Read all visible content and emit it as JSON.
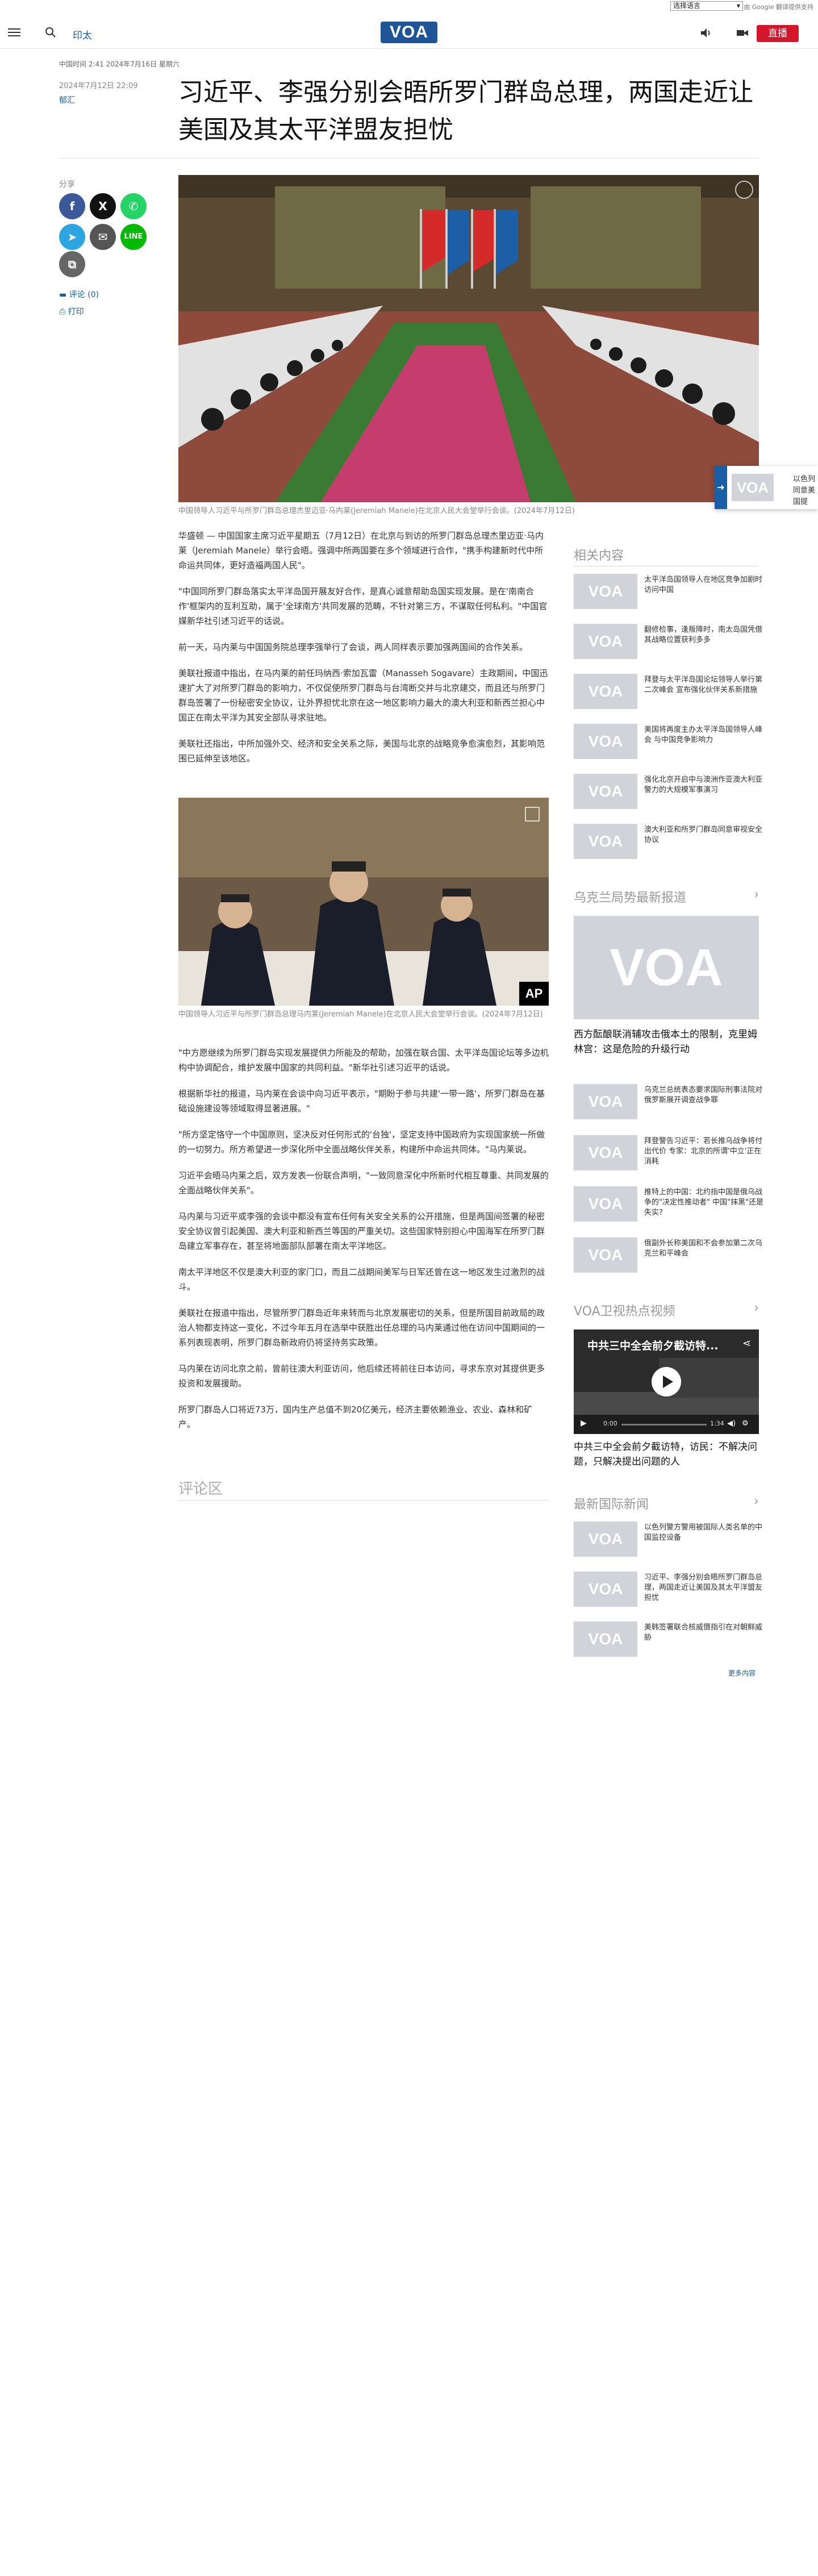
{
  "top_strip": {
    "language_select": "选择语言",
    "google_credit": "由 Google 翻译提供支持"
  },
  "header": {
    "section": "印太",
    "logo": "VOA",
    "live_label": "直播"
  },
  "meta": {
    "dateline": "中国时间 2:41 2024年7月16日 星期六",
    "published": "2024年7月12日 22:09",
    "byline": "郁汇"
  },
  "headline": "习近平、李强分别会晤所罗门群岛总理，两国走近让美国及其太平洋盟友担忧",
  "share": {
    "label": "分享",
    "comments": "评论 (0)",
    "print": "打印"
  },
  "hero_caption": "中国领导人习近平与所罗门群岛总理杰里迈亚·马内莱(Jeremiah Manele)在北京人民大会堂举行会谈。(2024年7月12日)",
  "popup_text": "以色列同意美国提",
  "paragraphs_a": [
    "华盛顿 — 中国国家主席习近平星期五（7月12日）在北京与到访的所罗门群岛总理杰里迈亚·马内莱（Jeremiah Manele）举行会晤。强调中所两国要在多个领域进行合作，\"携手构建新时代中所命运共同体，更好造福两国人民\"。",
    "\"中国同所罗门群岛落实太平洋岛国开展友好合作，是真心诚意帮助岛国实现发展。是在'南南合作'框架内的互利互助，属于'全球南方'共同发展的范畴，不针对第三方，不谋取任何私利。\"中国官媒新华社引述习近平的话说。",
    "前一天，马内莱与中国国务院总理李强举行了会谈，两人同样表示要加强两国间的合作关系。",
    "美联社报道中指出，在马内莱的前任玛纳西·索加瓦雷（Manasseh Sogavare）主政期间，中国迅速扩大了对所罗门群岛的影响力，不仅促使所罗门群岛与台湾断交并与北京建交，而且还与所罗门群岛签署了一份秘密安全协议，让外界担忧北京在这一地区影响力最大的澳大利亚和新西兰担心中国正在南太平洋为其安全部队寻求驻地。",
    "美联社还指出，中所加强外交、经济和安全关系之际，美国与北京的战略竞争愈演愈烈，其影响范围已延伸至该地区。"
  ],
  "inline_caption": "中国领导人习近平与所罗门群岛总理马内莱(Jeremiah Manele)在北京人民大会堂举行会谈。(2024年7月12日)",
  "ap_badge": "AP",
  "paragraphs_b": [
    "\"中方愿继续为所罗门群岛实现发展提供力所能及的帮助，加强在联合国、太平洋岛国论坛等多边机构中协调配合，维护发展中国家的共同利益。\"新华社引述习近平的话说。",
    "根据新华社的报道，马内莱在会谈中向习近平表示，\"期盼于参与共建'一带一路'，所罗门群岛在基础设施建设等领域取得显著进展。\"",
    "\"所方坚定恪守一个中国原则，坚决反对任何形式的'台独'，坚定支持中国政府为实现国家统一所做的一切努力。所方希望进一步深化所中全面战略伙伴关系，构建所中命运共同体。\"马内莱说。",
    "习近平会晤马内莱之后，双方发表一份联合声明，\"一致同意深化中所新时代相互尊重、共同发展的全面战略伙伴关系\"。",
    "马内莱与习近平或李强的会谈中都没有宣布任何有关安全关系的公开措施，但是两国间签署的秘密安全协议曾引起美国、澳大利亚和新西兰等国的严重关切。这些国家特别担心中国海军在所罗门群岛建立军事存在，甚至将地面部队部署在南太平洋地区。",
    "南太平洋地区不仅是澳大利亚的家门口，而且二战期间美军与日军还曾在这一地区发生过激烈的战斗。",
    "美联社在报道中指出，尽管所罗门群岛近年来转而与北京发展密切的关系，但是所国目前政局的政治人物都支持这一变化，不过今年五月在选举中获胜出任总理的马内莱通过他在访问中国期间的一系列表现表明，所罗门群岛新政府仍将坚持务实政策。",
    "马内莱在访问北京之前，曾前往澳大利亚访问，他后续还将前往日本访问，寻求东京对其提供更多投资和发展援助。",
    "所罗门群岛人口将近73万，国内生产总值不到20亿美元，经济主要依赖渔业、农业、森林和矿产。"
  ],
  "comments_section_title": "评论区",
  "sidebar": {
    "related": {
      "title": "相关内容",
      "items": [
        "太平洋岛国领导人在地区竞争加剧时访问中国",
        "翻修检事，逢叛降时，南太岛国凭借其战略位置获利多多",
        "拜登与太平洋岛国论坛领导人举行第二次峰会 宣布强化伙伴关系新措施",
        "美国将再度主办太平洋岛国领导人峰会 与中国竞争影响力",
        "强化北京开启中与澳洲作亚澳大利亚警力的大规模军事演习",
        "澳大利亚和所罗门群岛同意审视安全协议"
      ]
    },
    "ukraine": {
      "title": "乌克兰局势最新报道",
      "hero_title": "西方酝酿联消辅攻击俄本土的限制，克里姆林宫：这是危险的升级行动",
      "items": [
        "乌克兰总统表态要求国际刑事法院对俄罗斯展开调查战争罪",
        "拜登警告习近平：若长推乌战争将付出代价 专家：北京的所谓'中立'正在消耗",
        "推特上的中国：北约指中国是俄乌战争的\"决定性推动者\" 中国\"抹黑\"还是失实?",
        "俄副外长称美国和不会参加第二次乌克兰和平峰会"
      ]
    },
    "satellite": {
      "title": "VOA卫视热点视频",
      "video_overlay": "中共三中全会前夕截访特...",
      "elapsed": "0:00",
      "duration": "1:34",
      "caption": "中共三中全会前夕截访特，访民：不解决问题，只解决提出问题的人"
    },
    "intl": {
      "title": "最新国际新闻",
      "items": [
        "以色列警方警用被国际人类名单的中国监控设备",
        "习近平、李强分别会晤所罗门群岛总理，两国走近让美国及其太平洋盟友担忧",
        "美韩签署联合核威慑指引在对朝鲜威胁"
      ],
      "more": "更多内容"
    }
  }
}
